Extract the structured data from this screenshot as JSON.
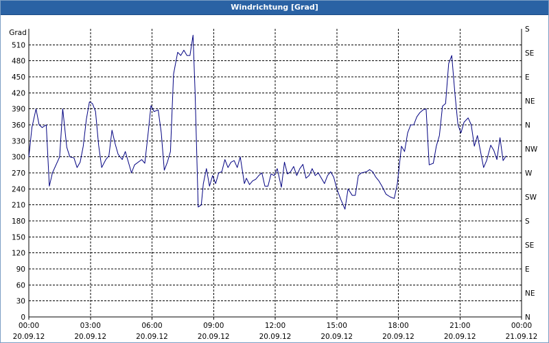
{
  "window": {
    "title": "Windrichtung [Grad]"
  },
  "chart_data": {
    "type": "line",
    "title": "Windrichtung [Grad]",
    "ylabel": "Grad",
    "ylim": [
      0,
      540
    ],
    "y_ticks": [
      0,
      30,
      60,
      90,
      120,
      150,
      180,
      210,
      240,
      270,
      300,
      330,
      360,
      390,
      420,
      450,
      480,
      510
    ],
    "right_axis_labels": [
      "N",
      "NE",
      "E",
      "SE",
      "S",
      "SW",
      "W",
      "NW",
      "N",
      "NE",
      "E",
      "SE",
      "S"
    ],
    "xlim_hours": [
      0,
      24
    ],
    "x_ticks": [
      {
        "hour": 0,
        "time": "00:00",
        "date": "20.09.12"
      },
      {
        "hour": 3,
        "time": "03:00",
        "date": "20.09.12"
      },
      {
        "hour": 6,
        "time": "06:00",
        "date": "20.09.12"
      },
      {
        "hour": 9,
        "time": "09:00",
        "date": "20.09.12"
      },
      {
        "hour": 12,
        "time": "12:00",
        "date": "20.09.12"
      },
      {
        "hour": 15,
        "time": "15:00",
        "date": "20.09.12"
      },
      {
        "hour": 18,
        "time": "18:00",
        "date": "20.09.12"
      },
      {
        "hour": 21,
        "time": "21:00",
        "date": "20.09.12"
      },
      {
        "hour": 24,
        "time": "00:00",
        "date": "21.09.12"
      }
    ],
    "grid": true,
    "line_color": "#000080",
    "series": [
      {
        "points": [
          [
            0.0,
            300
          ],
          [
            0.15,
            355
          ],
          [
            0.35,
            390
          ],
          [
            0.5,
            360
          ],
          [
            0.65,
            355
          ],
          [
            0.85,
            360
          ],
          [
            1.0,
            245
          ],
          [
            1.15,
            270
          ],
          [
            1.5,
            300
          ],
          [
            1.65,
            390
          ],
          [
            1.85,
            318
          ],
          [
            2.0,
            300
          ],
          [
            2.2,
            298
          ],
          [
            2.35,
            280
          ],
          [
            2.5,
            290
          ],
          [
            2.65,
            320
          ],
          [
            2.8,
            370
          ],
          [
            2.95,
            403
          ],
          [
            3.1,
            400
          ],
          [
            3.25,
            385
          ],
          [
            3.4,
            322
          ],
          [
            3.55,
            280
          ],
          [
            3.75,
            295
          ],
          [
            3.9,
            302
          ],
          [
            4.05,
            350
          ],
          [
            4.2,
            325
          ],
          [
            4.35,
            305
          ],
          [
            4.55,
            295
          ],
          [
            4.7,
            310
          ],
          [
            4.85,
            290
          ],
          [
            5.0,
            270
          ],
          [
            5.15,
            285
          ],
          [
            5.5,
            295
          ],
          [
            5.65,
            288
          ],
          [
            5.8,
            340
          ],
          [
            5.95,
            396
          ],
          [
            6.1,
            385
          ],
          [
            6.3,
            388
          ],
          [
            6.45,
            345
          ],
          [
            6.6,
            275
          ],
          [
            6.75,
            290
          ],
          [
            6.9,
            310
          ],
          [
            7.05,
            455
          ],
          [
            7.25,
            496
          ],
          [
            7.4,
            490
          ],
          [
            7.55,
            500
          ],
          [
            7.7,
            490
          ],
          [
            7.85,
            490
          ],
          [
            8.0,
            528
          ],
          [
            8.1,
            420
          ],
          [
            8.25,
            206
          ],
          [
            8.4,
            210
          ],
          [
            8.5,
            250
          ],
          [
            8.65,
            278
          ],
          [
            8.8,
            245
          ],
          [
            8.95,
            265
          ],
          [
            9.1,
            250
          ],
          [
            9.25,
            270
          ],
          [
            9.4,
            272
          ],
          [
            9.55,
            295
          ],
          [
            9.7,
            280
          ],
          [
            9.85,
            290
          ],
          [
            10.0,
            293
          ],
          [
            10.15,
            280
          ],
          [
            10.3,
            300
          ],
          [
            10.5,
            250
          ],
          [
            10.6,
            260
          ],
          [
            10.75,
            248
          ],
          [
            10.9,
            255
          ],
          [
            11.05,
            258
          ],
          [
            11.2,
            265
          ],
          [
            11.35,
            270
          ],
          [
            11.5,
            245
          ],
          [
            11.65,
            245
          ],
          [
            11.8,
            268
          ],
          [
            11.95,
            265
          ],
          [
            12.1,
            278
          ],
          [
            12.3,
            243
          ],
          [
            12.45,
            290
          ],
          [
            12.6,
            268
          ],
          [
            12.75,
            272
          ],
          [
            12.9,
            282
          ],
          [
            13.05,
            265
          ],
          [
            13.2,
            278
          ],
          [
            13.35,
            286
          ],
          [
            13.5,
            260
          ],
          [
            13.65,
            265
          ],
          [
            13.8,
            278
          ],
          [
            13.95,
            265
          ],
          [
            14.1,
            270
          ],
          [
            14.25,
            260
          ],
          [
            14.4,
            250
          ],
          [
            14.55,
            265
          ],
          [
            14.7,
            272
          ],
          [
            14.85,
            262
          ],
          [
            15.0,
            240
          ],
          [
            15.2,
            220
          ],
          [
            15.4,
            202
          ],
          [
            15.55,
            240
          ],
          [
            15.75,
            228
          ],
          [
            15.9,
            228
          ],
          [
            16.05,
            265
          ],
          [
            16.2,
            270
          ],
          [
            16.45,
            272
          ],
          [
            16.6,
            276
          ],
          [
            16.75,
            272
          ],
          [
            16.9,
            262
          ],
          [
            17.05,
            255
          ],
          [
            17.2,
            245
          ],
          [
            17.4,
            230
          ],
          [
            17.6,
            225
          ],
          [
            17.8,
            222
          ],
          [
            17.95,
            250
          ],
          [
            18.15,
            320
          ],
          [
            18.3,
            310
          ],
          [
            18.45,
            345
          ],
          [
            18.6,
            360
          ],
          [
            18.75,
            360
          ],
          [
            18.9,
            375
          ],
          [
            19.05,
            383
          ],
          [
            19.2,
            388
          ],
          [
            19.35,
            390
          ],
          [
            19.5,
            285
          ],
          [
            19.7,
            288
          ],
          [
            19.85,
            320
          ],
          [
            20.0,
            340
          ],
          [
            20.15,
            395
          ],
          [
            20.3,
            400
          ],
          [
            20.45,
            475
          ],
          [
            20.6,
            490
          ],
          [
            20.75,
            420
          ],
          [
            20.9,
            360
          ],
          [
            21.05,
            345
          ],
          [
            21.2,
            365
          ],
          [
            21.4,
            373
          ],
          [
            21.55,
            360
          ],
          [
            21.7,
            320
          ],
          [
            21.85,
            340
          ],
          [
            22.0,
            310
          ],
          [
            22.15,
            280
          ],
          [
            22.3,
            293
          ],
          [
            22.5,
            322
          ],
          [
            22.65,
            312
          ],
          [
            22.8,
            295
          ],
          [
            22.95,
            336
          ],
          [
            23.1,
            293
          ],
          [
            23.25,
            302
          ]
        ]
      }
    ]
  }
}
